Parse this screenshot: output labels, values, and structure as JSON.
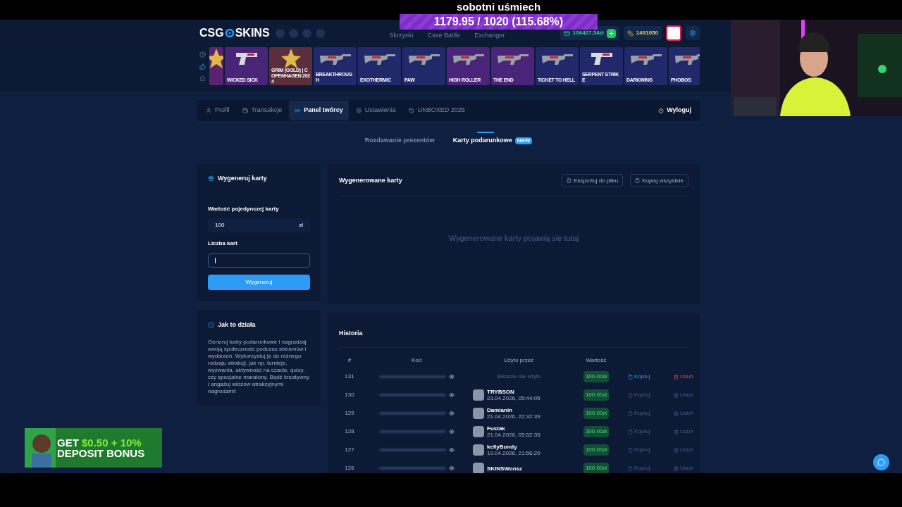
{
  "stream_overlay": {
    "title": "sobotni uśmiech",
    "goal": "1179.95 / 1020 (115.68%)"
  },
  "header": {
    "logo_left": "CSG",
    "logo_right": "SKINS",
    "nav": [
      {
        "label": "Skrzynki"
      },
      {
        "label": "Case Battle"
      },
      {
        "label": "Exchanger"
      }
    ],
    "balance": "106427.54zł",
    "coins": "1491050"
  },
  "drop_filters": [
    {
      "kind": "recent",
      "selected": false
    },
    {
      "kind": "liked",
      "selected": true
    },
    {
      "kind": "starred",
      "selected": false
    }
  ],
  "drops": [
    {
      "kind": "sticker",
      "color": "#5a2370"
    },
    {
      "name": "WICKED SICK",
      "kind": "pistol",
      "color": "#4a2478"
    },
    {
      "name": "GRIM (GOLD) | COPENHAGEN 2024",
      "kind": "sticker",
      "color": "#5a2e3c"
    },
    {
      "name": "BREAKTHROUGH",
      "kind": "rifle",
      "color": "#22296a"
    },
    {
      "name": "EXOTHERMIC",
      "kind": "rifle",
      "color": "#22296a"
    },
    {
      "name": "PAW",
      "kind": "rifle",
      "color": "#22296a"
    },
    {
      "name": "HIGH ROLLER",
      "kind": "rifle",
      "color": "#4a2478"
    },
    {
      "name": "THE END",
      "kind": "rifle",
      "color": "#4a2478"
    },
    {
      "name": "TICKET TO HELL",
      "kind": "rifle",
      "color": "#22296a"
    },
    {
      "name": "SERPENT STRIKE",
      "kind": "pistol",
      "color": "#22296a"
    },
    {
      "name": "DARKWING",
      "kind": "rifle",
      "color": "#22296a"
    },
    {
      "name": "PHOBOS",
      "kind": "rifle",
      "color": "#22296a"
    }
  ],
  "tabs": [
    {
      "label": "Profil",
      "kind": "user",
      "selected": false
    },
    {
      "label": "Transakcje",
      "kind": "wallet",
      "selected": false
    },
    {
      "label": "Panel twórcy",
      "kind": "broadcast",
      "selected": true
    },
    {
      "label": "Ustawienia",
      "kind": "gear",
      "selected": false
    },
    {
      "label": "UNBOXED 2025",
      "kind": "history",
      "selected": false
    }
  ],
  "logout": "Wyloguj",
  "subtabs": [
    {
      "label": "Rozdawanie prezentów",
      "selected": false
    },
    {
      "label": "Karty podarunkowe",
      "badge": "NEW",
      "selected": true
    }
  ],
  "generator": {
    "title": "Wygeneruj karty",
    "value_label": "Wartość pojedynczej karty",
    "value": "100",
    "unit": "zł",
    "count_label": "Liczba kart",
    "count_focused": true,
    "button": "Wygeneruj"
  },
  "generated": {
    "title": "Wygenerowane karty",
    "buttons": [
      {
        "label": "Eksportuj do pliku",
        "kind": "export"
      },
      {
        "label": "Kopiuj wszystkie",
        "kind": "copy"
      }
    ],
    "empty": "Wygenerowane karty pojawią się tutaj"
  },
  "info": {
    "title": "Jak to działa",
    "text": "Generuj karty podarunkowe i nagradzaj swoją społeczność podczas streamów i wydarzeń. Wykorzystuj je do różnego rodzaju atrakcji, jak np. turnieje, wyzwania, aktywność na czacie, quizy, czy specjalne maratony. Bądź kreatywny i angażuj widzów atrakcyjnymi nagrodami!"
  },
  "history": {
    "title": "Historia",
    "columns": [
      "#",
      "Kod",
      "Użyto przez",
      "Wartość"
    ],
    "rows": [
      {
        "id": "131",
        "unused": "Jeszcze nie użyto",
        "value": "100.00zł",
        "copy": "Kopiuj",
        "delete": "Usuń",
        "disabled": false
      },
      {
        "id": "130",
        "user": "TRYBSON",
        "date": "23.04.2026, 05:44:05",
        "value": "100.00zł",
        "copy": "Kopiuj",
        "delete": "Usuń",
        "disabled": true
      },
      {
        "id": "129",
        "user": "Damianin",
        "date": "21.04.2026, 22:32:39",
        "value": "100.00zł",
        "copy": "Kopiuj",
        "delete": "Usuń",
        "disabled": true
      },
      {
        "id": "128",
        "user": "Fustak",
        "date": "21.04.2026, 05:52:35",
        "value": "100.00zł",
        "copy": "Kopiuj",
        "delete": "Usuń",
        "disabled": true
      },
      {
        "id": "127",
        "user": "kellyBundy",
        "date": "19.04.2026, 21:56:29",
        "value": "100.00zł",
        "copy": "Kopiuj",
        "delete": "Usuń",
        "disabled": true
      },
      {
        "id": "126",
        "user": "SKINSWonsz",
        "value": "100.00zł",
        "copy": "Kopiuj",
        "delete": "Usuń",
        "disabled": true
      }
    ]
  },
  "promo": {
    "line1_left": "GET",
    "line1_right": "$0.50 + 10%",
    "line2": "DEPOSIT BONUS"
  }
}
